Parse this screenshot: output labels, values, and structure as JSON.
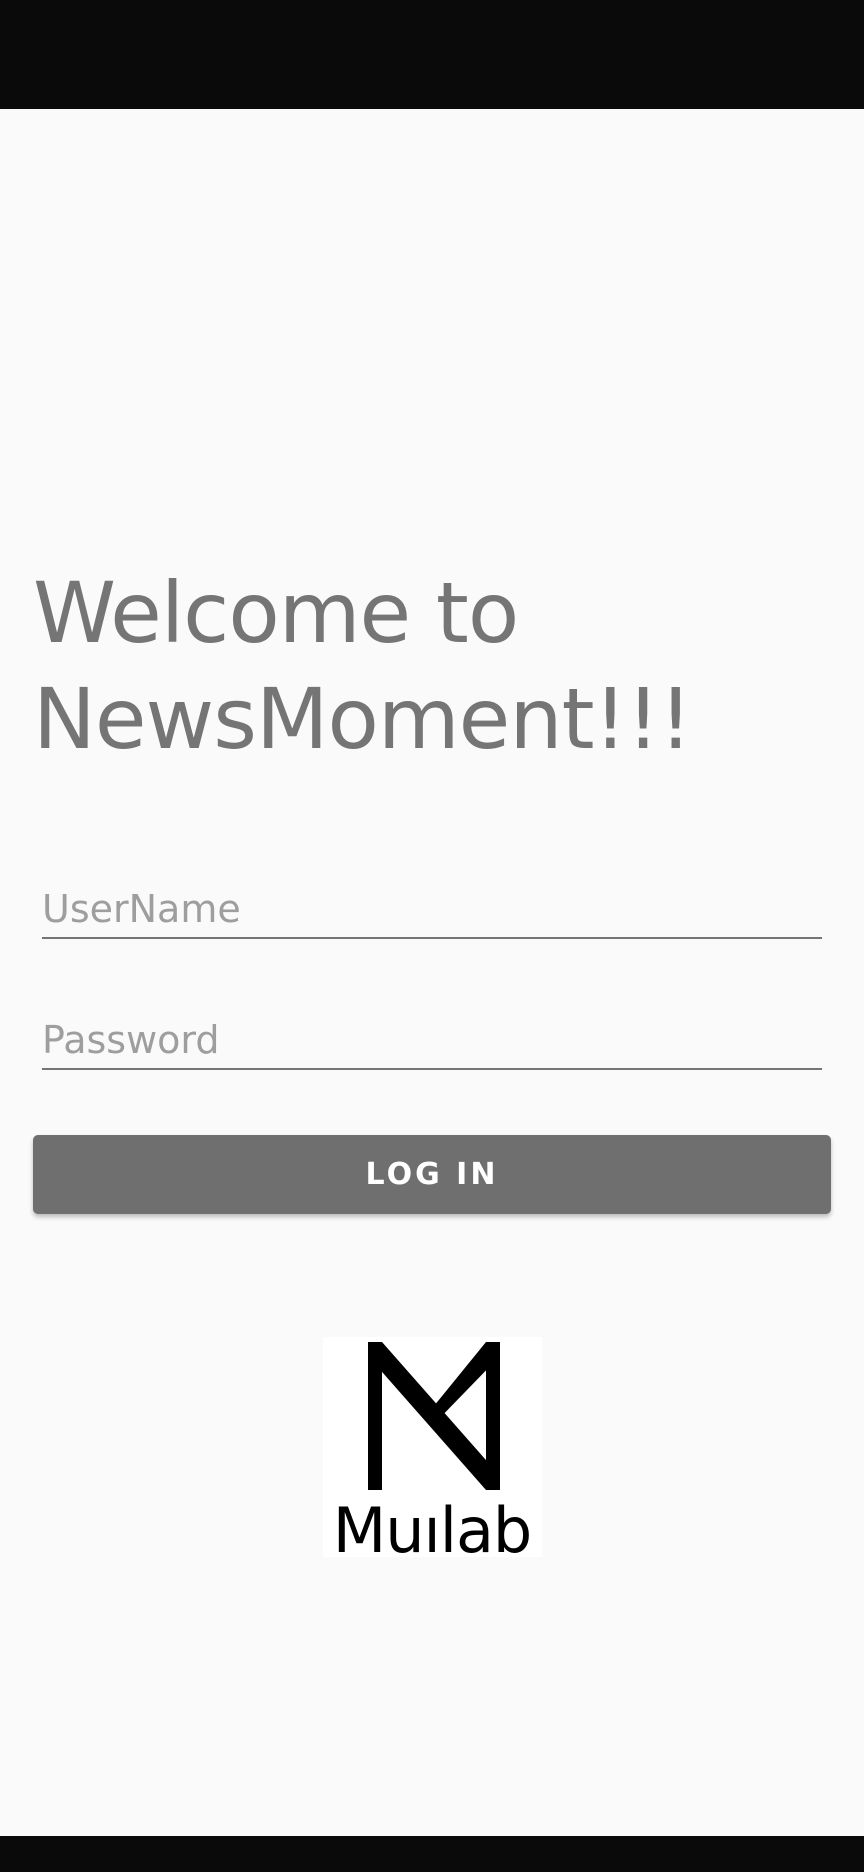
{
  "title": {
    "line1": "Welcome to",
    "line2": "NewsMoment!!!"
  },
  "form": {
    "username_placeholder": "UserName",
    "username_value": "",
    "password_placeholder": "Password",
    "password_value": "",
    "login_label": "LOG IN"
  },
  "logo": {
    "text": "Muılab",
    "icon": "muilab-logo-icon"
  },
  "colors": {
    "background": "#fafafa",
    "system_bars": "#0a0a0b",
    "title_text": "#757575",
    "button_background": "#6f6f6f",
    "button_text": "#ffffff"
  }
}
